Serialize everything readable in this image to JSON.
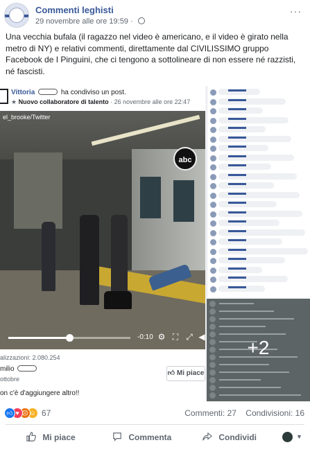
{
  "page": {
    "name": "Commenti leghisti",
    "timestamp": "29 novembre alle ore 19:59",
    "separator": "·"
  },
  "post": {
    "text": "Una vecchia bufala (il ragazzo nel video è americano, e il video è girato nella metro di NY) e relativi commenti, direttamente dal CIVILISSIMO gruppo Facebook de I Pinguini, che ci tengono a sottolineare di non essere né razzisti, né fascisti."
  },
  "shared_post": {
    "author": "Vittoria",
    "action": "ha condiviso un post.",
    "badge": "Nuovo collaboratore di talento",
    "date": "· 26 novembre alle ore 22:47",
    "video": {
      "source_watermark": "el_brooke/Twitter",
      "logo": "abc",
      "progress": 0.5,
      "time": "-0:10"
    },
    "views": "alizzazioni: 2.080.254",
    "commenter": "milio",
    "comment_date": "ottobre",
    "like_label": "Mi piace",
    "comment_snippet": "on c'è d'aggiungere altro!!"
  },
  "gallery": {
    "more_count": "+2"
  },
  "footer": {
    "reaction_icons": [
      "like-icon",
      "love-icon",
      "angry-icon",
      "haha-icon"
    ],
    "reaction_count": "67",
    "comments": "Commenti: 27",
    "shares": "Condivisioni: 16",
    "actions": {
      "like": "Mi piace",
      "comment": "Commenta",
      "share": "Condividi"
    }
  },
  "colors": {
    "brand": "#385898",
    "like": "#1877f2",
    "love": "#f33e58",
    "angry": "#e9710f",
    "haha": "#f7b125"
  }
}
